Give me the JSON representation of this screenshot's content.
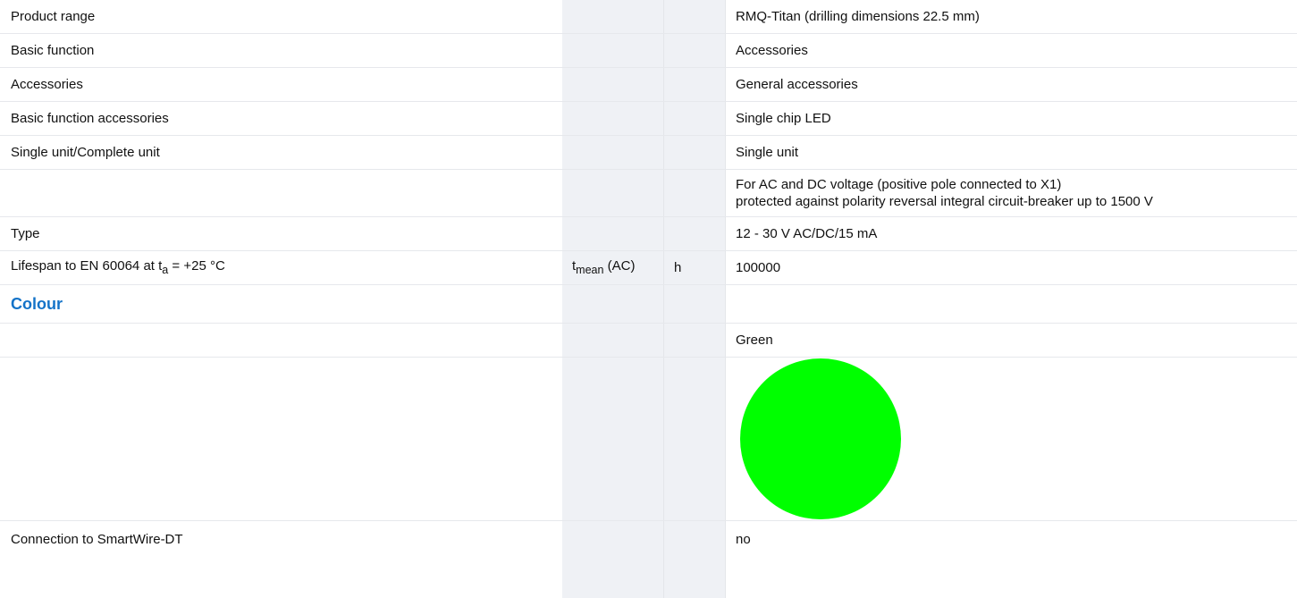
{
  "rows": [
    {
      "label": "Product range",
      "value": "RMQ-Titan (drilling dimensions 22.5 mm)"
    },
    {
      "label": "Basic function",
      "value": "Accessories"
    },
    {
      "label": "Accessories",
      "value": "General accessories"
    },
    {
      "label": "Basic function accessories",
      "value": "Single chip LED"
    },
    {
      "label": "Single unit/Complete unit",
      "value": "Single unit"
    },
    {
      "label": "",
      "value_lines": [
        "For AC and DC voltage (positive pole connected to X1)",
        "protected against polarity reversal integral circuit-breaker up to 1500 V"
      ]
    },
    {
      "label": "Type",
      "value": "12 - 30 V AC/DC/15 mA"
    },
    {
      "label_prefix": "Lifespan to EN 60064 at t",
      "label_sub": "a",
      "label_suffix": " = +25 °C",
      "symbol_main": "t",
      "symbol_sub": "mean",
      "symbol_suffix": " (AC)",
      "unit": "h",
      "value": "100000"
    }
  ],
  "section": {
    "title": "Colour"
  },
  "colour": {
    "name": "Green",
    "swatch_color": "#00ff00",
    "swatch_icon": "green-circle-icon"
  },
  "last_row": {
    "label": "Connection to SmartWire-DT",
    "value": "no"
  },
  "colors": {
    "section_blue": "#1473c8",
    "shade": "#eff1f5",
    "divider": "#e6e8ec"
  }
}
